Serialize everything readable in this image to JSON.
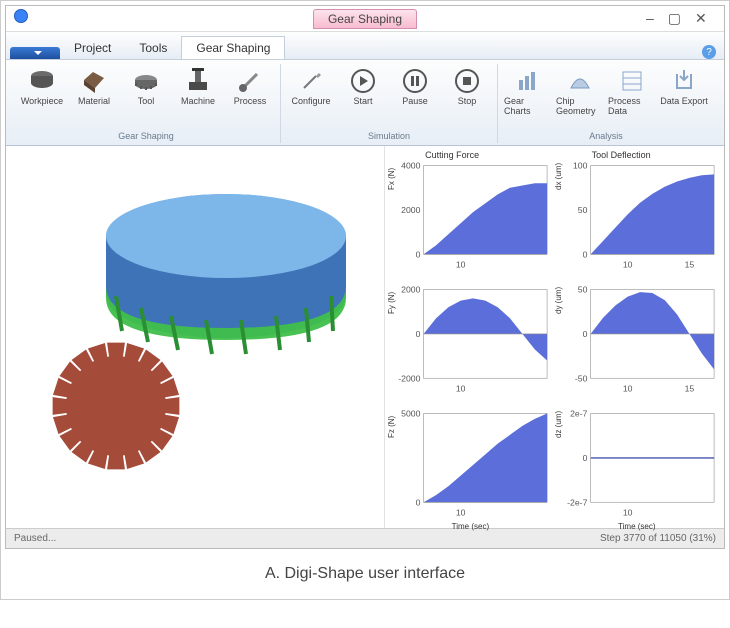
{
  "window": {
    "title": "Gear Shaping",
    "min": "–",
    "max": "▢",
    "close": "✕"
  },
  "menubar": {
    "file": "",
    "tabs": [
      "Project",
      "Tools",
      "Gear Shaping"
    ],
    "active_tab_index": 2
  },
  "ribbon": {
    "groups": [
      {
        "label": "Gear Shaping",
        "items": [
          {
            "icon": "workpiece-icon",
            "label": "Workpiece"
          },
          {
            "icon": "material-icon",
            "label": "Material"
          },
          {
            "icon": "tool-icon",
            "label": "Tool"
          },
          {
            "icon": "machine-icon",
            "label": "Machine"
          },
          {
            "icon": "process-icon",
            "label": "Process"
          }
        ]
      },
      {
        "label": "Simulation",
        "items": [
          {
            "icon": "configure-icon",
            "label": "Configure"
          },
          {
            "icon": "start-icon",
            "label": "Start"
          },
          {
            "icon": "pause-icon",
            "label": "Pause"
          },
          {
            "icon": "stop-icon",
            "label": "Stop"
          }
        ]
      },
      {
        "label": "Analysis",
        "items": [
          {
            "icon": "charts-icon",
            "label": "Gear Charts"
          },
          {
            "icon": "chip-icon",
            "label": "Chip Geometry"
          },
          {
            "icon": "pdata-icon",
            "label": "Process Data"
          },
          {
            "icon": "export-icon",
            "label": "Data Export"
          }
        ]
      }
    ]
  },
  "status": {
    "left": "Paused...",
    "right": "Step 3770 of 11050 (31%)"
  },
  "caption": "A. Digi-Shape user interface",
  "chart_data": [
    {
      "type": "area",
      "title": "Cutting Force",
      "ylabel": "Fx (N)",
      "xlabel": "Time (sec)",
      "x": [
        7,
        8,
        9,
        10,
        11,
        12,
        13,
        14,
        15,
        16,
        17
      ],
      "values": [
        0,
        400,
        900,
        1400,
        1900,
        2300,
        2700,
        3000,
        3100,
        3200,
        3200
      ],
      "ylim": [
        0,
        4000
      ],
      "xlim": [
        7,
        17
      ],
      "yticks": [
        0,
        2000,
        4000
      ],
      "xticks": [
        10
      ]
    },
    {
      "type": "area",
      "title": "Tool Deflection",
      "ylabel": "dx (um)",
      "xlabel": "Time (sec)",
      "x": [
        7,
        8,
        9,
        10,
        11,
        12,
        13,
        14,
        15,
        16,
        17
      ],
      "values": [
        0,
        15,
        30,
        45,
        58,
        68,
        76,
        82,
        86,
        89,
        90
      ],
      "ylim": [
        0,
        100
      ],
      "xlim": [
        7,
        17
      ],
      "yticks": [
        0,
        50,
        100
      ],
      "xticks": [
        10,
        15
      ]
    },
    {
      "type": "area",
      "title": "",
      "ylabel": "Fy (N)",
      "xlabel": "Time (sec)",
      "x": [
        7,
        8,
        9,
        10,
        11,
        12,
        13,
        14,
        15,
        16,
        17
      ],
      "values": [
        0,
        700,
        1200,
        1500,
        1600,
        1500,
        1200,
        700,
        0,
        -700,
        -1200
      ],
      "ylim": [
        -2000,
        2000
      ],
      "xlim": [
        7,
        17
      ],
      "yticks": [
        -2000,
        0,
        2000
      ],
      "xticks": [
        10
      ]
    },
    {
      "type": "area",
      "title": "",
      "ylabel": "dy (um)",
      "xlabel": "Time (sec)",
      "x": [
        7,
        8,
        9,
        10,
        11,
        12,
        13,
        14,
        15,
        16,
        17
      ],
      "values": [
        0,
        18,
        32,
        42,
        47,
        46,
        38,
        22,
        0,
        -22,
        -40
      ],
      "ylim": [
        -50,
        50
      ],
      "xlim": [
        7,
        17
      ],
      "yticks": [
        -50,
        0,
        50
      ],
      "xticks": [
        10,
        15
      ]
    },
    {
      "type": "area",
      "title": "",
      "ylabel": "Fz (N)",
      "xlabel": "Time (sec)",
      "x": [
        7,
        8,
        9,
        10,
        11,
        12,
        13,
        14,
        15,
        16,
        17
      ],
      "values": [
        0,
        400,
        900,
        1500,
        2100,
        2700,
        3300,
        3800,
        4300,
        4700,
        5000
      ],
      "ylim": [
        0,
        5000
      ],
      "xlim": [
        7,
        17
      ],
      "yticks": [
        0,
        5000
      ],
      "xticks": [
        10
      ]
    },
    {
      "type": "line",
      "title": "",
      "ylabel": "dz (um)",
      "xlabel": "Time (sec)",
      "x": [
        7,
        17
      ],
      "values": [
        0,
        0
      ],
      "ylim": [
        -2e-07,
        2e-07
      ],
      "xlim": [
        7,
        17
      ],
      "yticks": [
        -2e-07,
        0,
        2e-07
      ],
      "xticks": [
        10
      ],
      "ytick_labels": [
        "-2e-7",
        "0",
        "2e-7"
      ]
    }
  ]
}
